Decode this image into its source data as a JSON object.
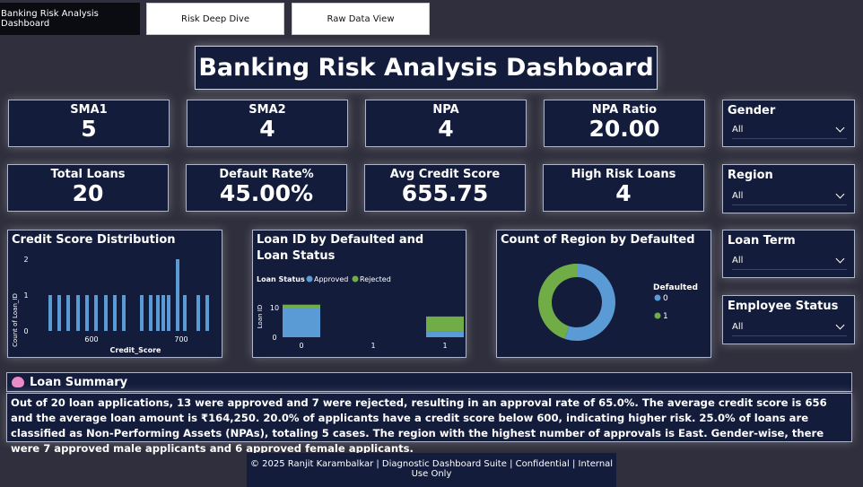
{
  "tabs": [
    {
      "label": "Banking Risk Analysis Dashboard",
      "active": true
    },
    {
      "label": "Risk Deep Dive",
      "active": false
    },
    {
      "label": "Raw Data View",
      "active": false
    }
  ],
  "title": "Banking Risk Analysis Dashboard",
  "kpis": {
    "sma1": {
      "label": "SMA1",
      "value": "5"
    },
    "sma2": {
      "label": "SMA2",
      "value": "4"
    },
    "npa": {
      "label": "NPA",
      "value": "4"
    },
    "npa_ratio": {
      "label": "NPA Ratio",
      "value": "20.00"
    },
    "total_loans": {
      "label": "Total Loans",
      "value": "20"
    },
    "default_rate": {
      "label": "Default Rate%",
      "value": "45.00%"
    },
    "avg_credit": {
      "label": "Avg Credit Score",
      "value": "655.75"
    },
    "high_risk": {
      "label": "High Risk Loans",
      "value": "4"
    }
  },
  "slicers": {
    "gender": {
      "title": "Gender",
      "value": "All"
    },
    "region": {
      "title": "Region",
      "value": "All"
    },
    "loan_term": {
      "title": "Loan Term",
      "value": "All"
    },
    "employee_status": {
      "title": "Employee Status",
      "value": "All"
    }
  },
  "colors": {
    "blue": "#5b9bd5",
    "green": "#70ad47",
    "panel": "#141c3c"
  },
  "chart_data": [
    {
      "type": "bar",
      "title": "Credit Score Distribution",
      "xlabel": "Credit_Score",
      "ylabel": "Count of Loan_ID",
      "x_ticks": [
        "600",
        "700"
      ],
      "y_ticks": [
        "0",
        "1",
        "2"
      ],
      "ylim": [
        0,
        2
      ],
      "x": [
        552,
        562,
        572,
        583,
        593,
        603,
        614,
        624,
        634,
        654,
        664,
        672,
        678,
        684,
        694,
        702,
        717,
        727
      ],
      "values": [
        1,
        1,
        1,
        1,
        1,
        1,
        1,
        1,
        1,
        1,
        1,
        1,
        1,
        1,
        2,
        1,
        1,
        1
      ]
    },
    {
      "type": "bar",
      "title": "Loan ID by Defaulted and Loan Status",
      "legend_title": "Loan Status",
      "ylabel": "Loan ID",
      "y_ticks": [
        "0",
        "10"
      ],
      "categories": [
        "0",
        "1",
        "1"
      ],
      "series": [
        {
          "name": "Approved",
          "color": "#5b9bd5",
          "values": [
            10,
            0,
            2
          ]
        },
        {
          "name": "Rejected",
          "color": "#70ad47",
          "values": [
            1,
            0,
            5
          ]
        }
      ]
    },
    {
      "type": "pie",
      "title": "Count of Region by Defaulted",
      "legend_title": "Defaulted",
      "slices": [
        {
          "label": "0",
          "value": 11,
          "color": "#5b9bd5"
        },
        {
          "label": "1",
          "value": 9,
          "color": "#70ad47"
        }
      ]
    }
  ],
  "summary": {
    "title": "Loan Summary",
    "text": "Out of 20 loan applications, 13 were approved and 7 were rejected, resulting in an approval rate of 65.0%. The average credit score is 656 and the average loan amount is ₹164,250. 20.0% of applicants have a credit score below 600, indicating higher risk. 25.0% of loans are classified as Non-Performing Assets (NPAs), totaling 5 cases. The region with the highest number of approvals is East. Gender-wise, there were 7 approved male applicants and 6 approved female applicants."
  },
  "footer": "© 2025 Ranjit Karambalkar | Diagnostic Dashboard Suite | Confidential | Internal Use Only"
}
